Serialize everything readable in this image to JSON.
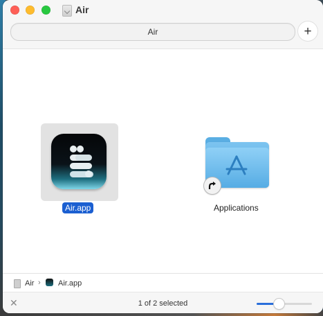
{
  "window": {
    "title": "Air",
    "title_icon": "disk-image-icon"
  },
  "toolbar": {
    "path_label": "Air",
    "add_tab_label": "+"
  },
  "items": [
    {
      "name": "Air.app",
      "icon": "air-app-icon",
      "selected": true
    },
    {
      "name": "Applications",
      "icon": "applications-folder-icon",
      "alias": true
    }
  ],
  "pathbar": {
    "segments": [
      {
        "label": "Air",
        "icon": "disk-image-icon"
      },
      {
        "label": "Air.app",
        "icon": "air-app-icon"
      }
    ],
    "separator": "›"
  },
  "statusbar": {
    "close_label": "✕",
    "status_text": "1 of 2 selected",
    "icon_size_level": 0.4
  },
  "colors": {
    "selection": "#1b5fd1",
    "folder": "#5aaee3"
  }
}
